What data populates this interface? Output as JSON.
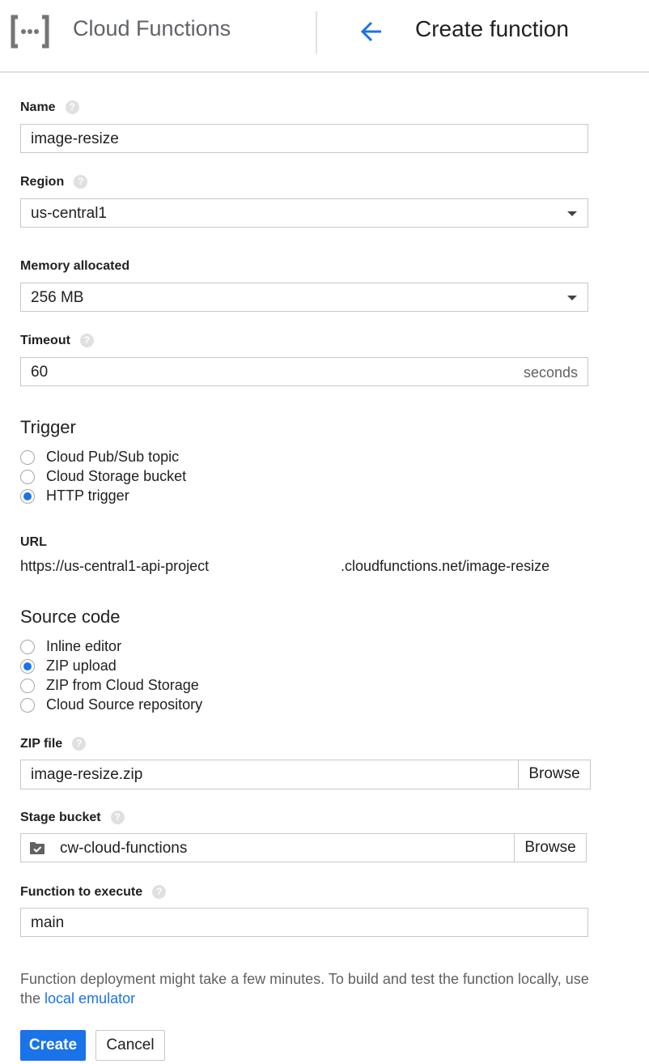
{
  "header": {
    "product_name": "Cloud Functions",
    "page_title": "Create function"
  },
  "form": {
    "name": {
      "label": "Name",
      "value": "image-resize"
    },
    "region": {
      "label": "Region",
      "value": "us-central1"
    },
    "memory": {
      "label": "Memory allocated",
      "value": "256 MB"
    },
    "timeout": {
      "label": "Timeout",
      "value": "60",
      "suffix": "seconds"
    },
    "trigger": {
      "title": "Trigger",
      "options": [
        {
          "label": "Cloud Pub/Sub topic",
          "checked": false
        },
        {
          "label": "Cloud Storage bucket",
          "checked": false
        },
        {
          "label": "HTTP trigger",
          "checked": true
        }
      ]
    },
    "url": {
      "label": "URL",
      "prefix": "https://us-central1-api-project",
      "suffix": ".cloudfunctions.net/image-resize"
    },
    "source": {
      "title": "Source code",
      "options": [
        {
          "label": "Inline editor",
          "checked": false
        },
        {
          "label": "ZIP upload",
          "checked": true
        },
        {
          "label": "ZIP from Cloud Storage",
          "checked": false
        },
        {
          "label": "Cloud Source repository",
          "checked": false
        }
      ]
    },
    "zip_file": {
      "label": "ZIP file",
      "value": "image-resize.zip",
      "browse_label": "Browse"
    },
    "stage_bucket": {
      "label": "Stage bucket",
      "value": "cw-cloud-functions",
      "browse_label": "Browse"
    },
    "function_to_execute": {
      "label": "Function to execute",
      "value": "main"
    }
  },
  "note": {
    "text": "Function deployment might take a few minutes. To build and test the function locally, use the ",
    "link_text": "local emulator"
  },
  "actions": {
    "create_label": "Create",
    "cancel_label": "Cancel"
  },
  "colors": {
    "accent": "#1a73e8",
    "help_icon": "#e0e0e0",
    "border": "#c8c8c8"
  },
  "icons": {
    "logo": "cloud-functions-logo",
    "back": "arrow-back-icon",
    "help": "help-icon",
    "dropdown": "chevron-down-icon",
    "bucket": "folder-check-icon"
  }
}
